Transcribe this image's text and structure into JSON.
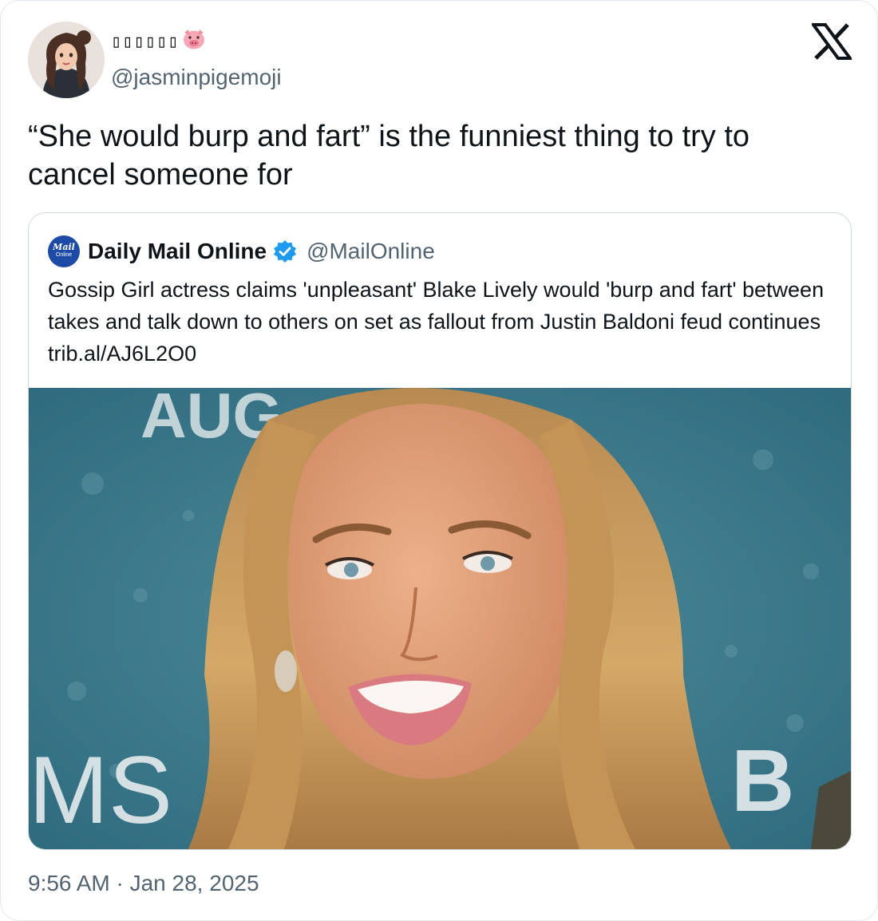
{
  "tweet": {
    "display_name_glyphs": "▯▯▯▯▯▯",
    "display_name_emoji": "pig-face-emoji",
    "handle": "@jasminpigemoji",
    "text": "“She would burp and fart” is the funniest thing to try to cancel someone for",
    "timestamp": "9:56 AM · Jan 28, 2025"
  },
  "quoted_tweet": {
    "logo_line1": "Mail",
    "logo_line2": "Online",
    "display_name": "Daily Mail Online",
    "verified": true,
    "handle": "@MailOnline",
    "text": "Gossip Girl actress claims 'unpleasant' Blake Lively would 'burp and fart' between takes and talk down to others on set as fallout from Justin Baldoni feud continues trib.al/AJ6L2O0",
    "image_backdrop_text_left": "MS",
    "image_backdrop_text_top": "AUG",
    "image_backdrop_text_right": "B"
  },
  "colors": {
    "text_primary": "#0f1419",
    "text_secondary": "#536471",
    "verified_blue": "#1d9bf0",
    "backdrop_teal": "#3f7f92",
    "hair": "#c89a5a",
    "skin": "#e0a27c"
  },
  "icons": [
    "x-logo-icon",
    "verified-badge-icon",
    "pig-face-emoji"
  ]
}
